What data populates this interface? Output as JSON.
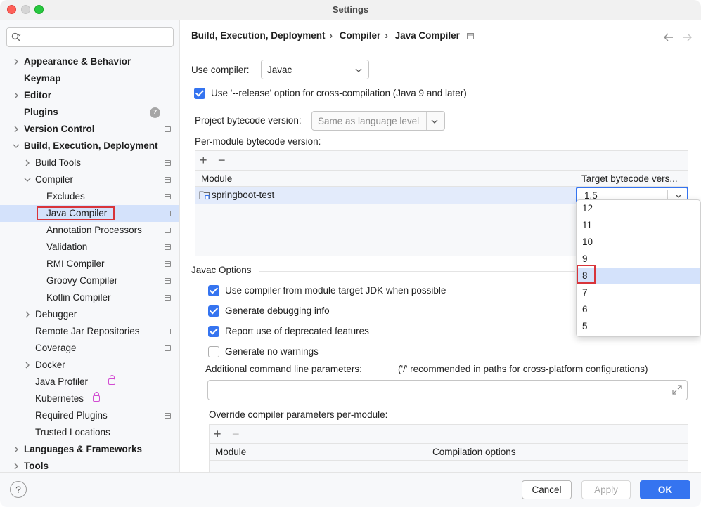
{
  "window": {
    "title": "Settings"
  },
  "sidebar": {
    "search_placeholder": "",
    "items": [
      {
        "label": "Appearance & Behavior",
        "bold": true,
        "chevron": "right",
        "level": 0
      },
      {
        "label": "Keymap",
        "bold": true,
        "chevron": "",
        "level": 0
      },
      {
        "label": "Editor",
        "bold": true,
        "chevron": "right",
        "level": 0
      },
      {
        "label": "Plugins",
        "bold": true,
        "chevron": "",
        "level": 0,
        "badge": "7"
      },
      {
        "label": "Version Control",
        "bold": true,
        "chevron": "right",
        "level": 0,
        "page_icon": true
      },
      {
        "label": "Build, Execution, Deployment",
        "bold": true,
        "chevron": "down",
        "level": 0
      },
      {
        "label": "Build Tools",
        "chevron": "right",
        "level": 1,
        "page_icon": true
      },
      {
        "label": "Compiler",
        "chevron": "down",
        "level": 1,
        "page_icon": true
      },
      {
        "label": "Excludes",
        "level": 2,
        "page_icon": true
      },
      {
        "label": "Java Compiler",
        "level": 2,
        "page_icon": true,
        "selected": true
      },
      {
        "label": "Annotation Processors",
        "level": 2,
        "page_icon": true
      },
      {
        "label": "Validation",
        "level": 2,
        "page_icon": true
      },
      {
        "label": "RMI Compiler",
        "level": 2,
        "page_icon": true
      },
      {
        "label": "Groovy Compiler",
        "level": 2,
        "page_icon": true
      },
      {
        "label": "Kotlin Compiler",
        "level": 2,
        "page_icon": true
      },
      {
        "label": "Debugger",
        "chevron": "right",
        "level": 1
      },
      {
        "label": "Remote Jar Repositories",
        "level": 1,
        "page_icon": true
      },
      {
        "label": "Coverage",
        "level": 1,
        "page_icon": true
      },
      {
        "label": "Docker",
        "chevron": "right",
        "level": 1
      },
      {
        "label": "Java Profiler",
        "level": 1,
        "lock": true
      },
      {
        "label": "Kubernetes",
        "level": 1,
        "lock": true
      },
      {
        "label": "Required Plugins",
        "level": 1,
        "page_icon": true
      },
      {
        "label": "Trusted Locations",
        "level": 1
      },
      {
        "label": "Languages & Frameworks",
        "bold": true,
        "chevron": "right",
        "level": 0
      },
      {
        "label": "Tools",
        "bold": true,
        "chevron": "right",
        "level": 0
      }
    ]
  },
  "breadcrumb": [
    "Build, Execution, Deployment",
    "Compiler",
    "Java Compiler"
  ],
  "breadcrumb_separator": "›",
  "icons": {
    "back": "arrow-left-icon",
    "forward": "arrow-right-icon",
    "search": "search-icon",
    "help": "help-icon"
  },
  "compiler": {
    "use_compiler_label": "Use compiler:",
    "use_compiler_value": "Javac",
    "release_option_label": "Use '--release' option for cross-compilation (Java 9 and later)",
    "release_option_checked": true,
    "project_bytecode_label": "Project bytecode version:",
    "project_bytecode_value": "Same as language level",
    "per_module_label": "Per-module bytecode version:",
    "table_header_module": "Module",
    "table_header_target": "Target bytecode vers...",
    "row_module": "springboot-test",
    "row_target": "1.5"
  },
  "dropdown_options": [
    "12",
    "11",
    "10",
    "9",
    "8",
    "7",
    "6",
    "5"
  ],
  "dropdown_highlighted": "8",
  "javac": {
    "section_label": "Javac Options",
    "options": [
      {
        "label": "Use compiler from module target JDK when possible",
        "checked": true
      },
      {
        "label": "Generate debugging info",
        "checked": true
      },
      {
        "label": "Report use of deprecated features",
        "checked": true
      },
      {
        "label": "Generate no warnings",
        "checked": false
      }
    ],
    "additional_params_label": "Additional command line parameters:",
    "additional_params_hint": "('/' recommended in paths for cross-platform configurations)",
    "additional_params_value": "",
    "override_label": "Override compiler parameters per-module:",
    "override_header_module": "Module",
    "override_header_options": "Compilation options"
  },
  "toolbar": {
    "add": "+",
    "remove": "−"
  },
  "buttons": {
    "help": "?",
    "cancel": "Cancel",
    "apply": "Apply",
    "ok": "OK"
  },
  "colors": {
    "accent": "#3574f0",
    "selection": "#d4e2fb",
    "highlight_box": "#d8343a"
  }
}
